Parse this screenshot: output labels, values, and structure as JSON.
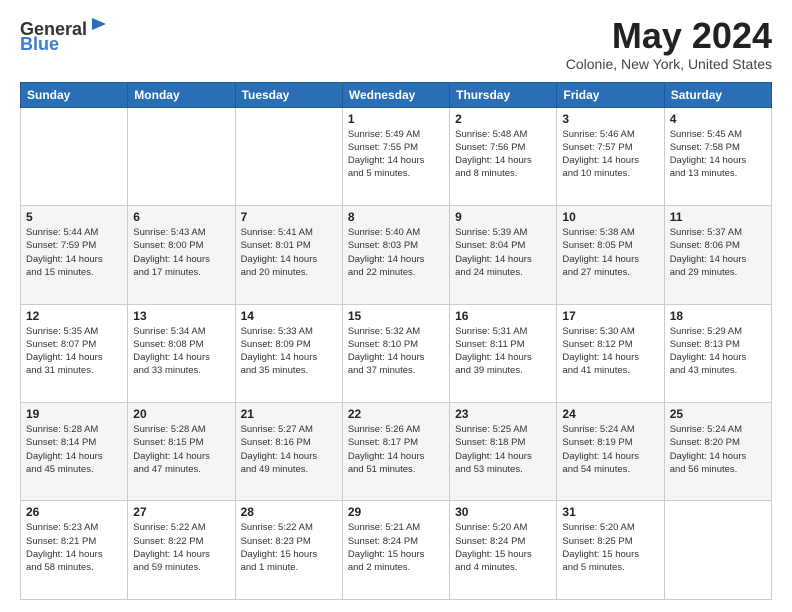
{
  "header": {
    "logo_general": "General",
    "logo_blue": "Blue",
    "month_title": "May 2024",
    "location": "Colonie, New York, United States"
  },
  "calendar": {
    "days_of_week": [
      "Sunday",
      "Monday",
      "Tuesday",
      "Wednesday",
      "Thursday",
      "Friday",
      "Saturday"
    ],
    "weeks": [
      [
        {
          "day": "",
          "info": ""
        },
        {
          "day": "",
          "info": ""
        },
        {
          "day": "",
          "info": ""
        },
        {
          "day": "1",
          "info": "Sunrise: 5:49 AM\nSunset: 7:55 PM\nDaylight: 14 hours\nand 5 minutes."
        },
        {
          "day": "2",
          "info": "Sunrise: 5:48 AM\nSunset: 7:56 PM\nDaylight: 14 hours\nand 8 minutes."
        },
        {
          "day": "3",
          "info": "Sunrise: 5:46 AM\nSunset: 7:57 PM\nDaylight: 14 hours\nand 10 minutes."
        },
        {
          "day": "4",
          "info": "Sunrise: 5:45 AM\nSunset: 7:58 PM\nDaylight: 14 hours\nand 13 minutes."
        }
      ],
      [
        {
          "day": "5",
          "info": "Sunrise: 5:44 AM\nSunset: 7:59 PM\nDaylight: 14 hours\nand 15 minutes."
        },
        {
          "day": "6",
          "info": "Sunrise: 5:43 AM\nSunset: 8:00 PM\nDaylight: 14 hours\nand 17 minutes."
        },
        {
          "day": "7",
          "info": "Sunrise: 5:41 AM\nSunset: 8:01 PM\nDaylight: 14 hours\nand 20 minutes."
        },
        {
          "day": "8",
          "info": "Sunrise: 5:40 AM\nSunset: 8:03 PM\nDaylight: 14 hours\nand 22 minutes."
        },
        {
          "day": "9",
          "info": "Sunrise: 5:39 AM\nSunset: 8:04 PM\nDaylight: 14 hours\nand 24 minutes."
        },
        {
          "day": "10",
          "info": "Sunrise: 5:38 AM\nSunset: 8:05 PM\nDaylight: 14 hours\nand 27 minutes."
        },
        {
          "day": "11",
          "info": "Sunrise: 5:37 AM\nSunset: 8:06 PM\nDaylight: 14 hours\nand 29 minutes."
        }
      ],
      [
        {
          "day": "12",
          "info": "Sunrise: 5:35 AM\nSunset: 8:07 PM\nDaylight: 14 hours\nand 31 minutes."
        },
        {
          "day": "13",
          "info": "Sunrise: 5:34 AM\nSunset: 8:08 PM\nDaylight: 14 hours\nand 33 minutes."
        },
        {
          "day": "14",
          "info": "Sunrise: 5:33 AM\nSunset: 8:09 PM\nDaylight: 14 hours\nand 35 minutes."
        },
        {
          "day": "15",
          "info": "Sunrise: 5:32 AM\nSunset: 8:10 PM\nDaylight: 14 hours\nand 37 minutes."
        },
        {
          "day": "16",
          "info": "Sunrise: 5:31 AM\nSunset: 8:11 PM\nDaylight: 14 hours\nand 39 minutes."
        },
        {
          "day": "17",
          "info": "Sunrise: 5:30 AM\nSunset: 8:12 PM\nDaylight: 14 hours\nand 41 minutes."
        },
        {
          "day": "18",
          "info": "Sunrise: 5:29 AM\nSunset: 8:13 PM\nDaylight: 14 hours\nand 43 minutes."
        }
      ],
      [
        {
          "day": "19",
          "info": "Sunrise: 5:28 AM\nSunset: 8:14 PM\nDaylight: 14 hours\nand 45 minutes."
        },
        {
          "day": "20",
          "info": "Sunrise: 5:28 AM\nSunset: 8:15 PM\nDaylight: 14 hours\nand 47 minutes."
        },
        {
          "day": "21",
          "info": "Sunrise: 5:27 AM\nSunset: 8:16 PM\nDaylight: 14 hours\nand 49 minutes."
        },
        {
          "day": "22",
          "info": "Sunrise: 5:26 AM\nSunset: 8:17 PM\nDaylight: 14 hours\nand 51 minutes."
        },
        {
          "day": "23",
          "info": "Sunrise: 5:25 AM\nSunset: 8:18 PM\nDaylight: 14 hours\nand 53 minutes."
        },
        {
          "day": "24",
          "info": "Sunrise: 5:24 AM\nSunset: 8:19 PM\nDaylight: 14 hours\nand 54 minutes."
        },
        {
          "day": "25",
          "info": "Sunrise: 5:24 AM\nSunset: 8:20 PM\nDaylight: 14 hours\nand 56 minutes."
        }
      ],
      [
        {
          "day": "26",
          "info": "Sunrise: 5:23 AM\nSunset: 8:21 PM\nDaylight: 14 hours\nand 58 minutes."
        },
        {
          "day": "27",
          "info": "Sunrise: 5:22 AM\nSunset: 8:22 PM\nDaylight: 14 hours\nand 59 minutes."
        },
        {
          "day": "28",
          "info": "Sunrise: 5:22 AM\nSunset: 8:23 PM\nDaylight: 15 hours\nand 1 minute."
        },
        {
          "day": "29",
          "info": "Sunrise: 5:21 AM\nSunset: 8:24 PM\nDaylight: 15 hours\nand 2 minutes."
        },
        {
          "day": "30",
          "info": "Sunrise: 5:20 AM\nSunset: 8:24 PM\nDaylight: 15 hours\nand 4 minutes."
        },
        {
          "day": "31",
          "info": "Sunrise: 5:20 AM\nSunset: 8:25 PM\nDaylight: 15 hours\nand 5 minutes."
        },
        {
          "day": "",
          "info": ""
        }
      ]
    ]
  }
}
